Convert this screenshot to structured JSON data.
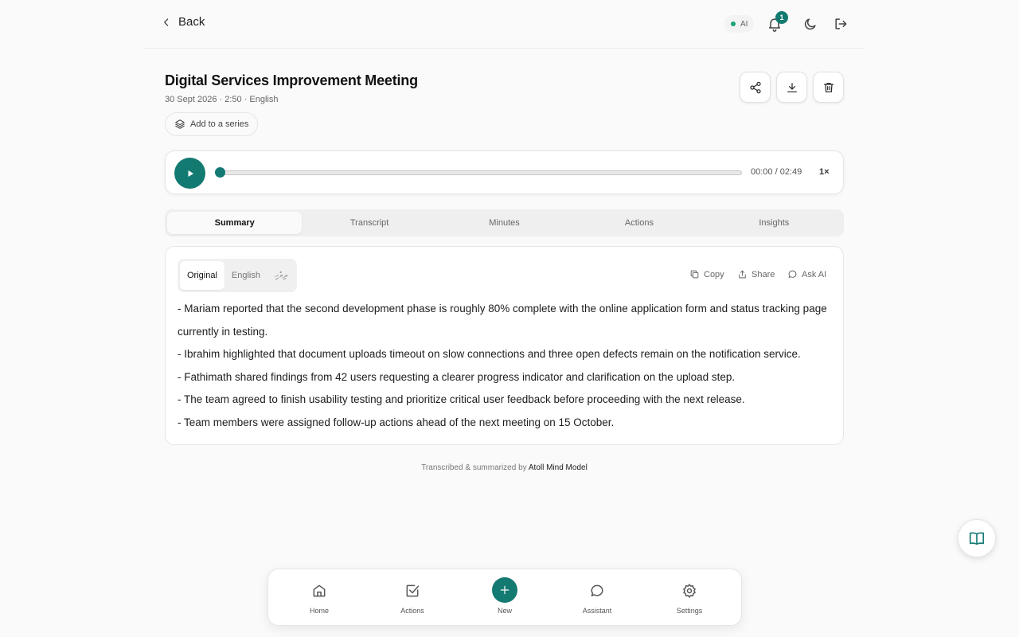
{
  "header": {
    "back_label": "Back",
    "ai_label": "AI",
    "notification_count": "1"
  },
  "meeting": {
    "title": "Digital Services Improvement Meeting",
    "meta": "30 Sept 2026 · 2:50 · English",
    "series_label": "Add to a series"
  },
  "player": {
    "time": "00:00 / 02:49",
    "speed": "1×",
    "progress": 0
  },
  "tabs": [
    {
      "label": "Summary",
      "active": true
    },
    {
      "label": "Transcript",
      "active": false
    },
    {
      "label": "Minutes",
      "active": false
    },
    {
      "label": "Actions",
      "active": false
    },
    {
      "label": "Insights",
      "active": false
    }
  ],
  "summary": {
    "languages": [
      "Original",
      "English",
      "ދިވެހި"
    ],
    "active_language": "Original",
    "actions": {
      "copy": "Copy",
      "share": "Share",
      "ask_ai": "Ask AI"
    },
    "items": [
      "- Mariam reported that the second development phase is roughly 80% complete with the online application form and status tracking page currently in testing.",
      "- Ibrahim highlighted that document uploads timeout on slow connections and three open defects remain on the notification service.",
      "- Fathimath shared findings from 42 users requesting a clearer progress indicator and clarification on the upload step.",
      "- The team agreed to finish usability testing and prioritize critical user feedback before proceeding with the next release.",
      "- Team members were assigned follow-up actions ahead of the next meeting on 15 October."
    ]
  },
  "footer": {
    "prefix": "Transcribed & summarized by",
    "brand": "Atoll Mind Model"
  },
  "nav": {
    "home": "Home",
    "actions": "Actions",
    "new": "New",
    "assistant": "Assistant",
    "settings": "Settings"
  },
  "colors": {
    "accent": "#137a72",
    "status_ok": "#1aa37a",
    "background": "#fafafa"
  },
  "icons": [
    "chevron-left-icon",
    "bell-icon",
    "moon-icon",
    "logout-icon",
    "share-nodes-icon",
    "download-icon",
    "trash-icon",
    "layers-icon",
    "play-icon",
    "copy-icon",
    "upload-share-icon",
    "chat-bubble-icon",
    "book-icon",
    "home-icon",
    "check-square-icon",
    "plus-icon",
    "gear-icon"
  ]
}
